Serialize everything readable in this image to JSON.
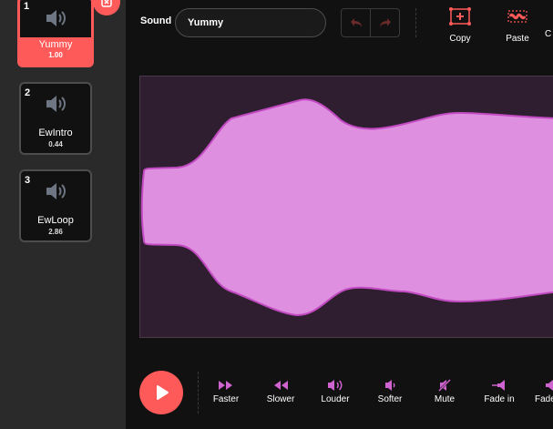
{
  "sidebar": {
    "items": [
      {
        "number": "1",
        "name": "Yummy",
        "duration": "1.00",
        "selected": true
      },
      {
        "number": "2",
        "name": "EwIntro",
        "duration": "0.44",
        "selected": false
      },
      {
        "number": "3",
        "name": "EwLoop",
        "duration": "2.86",
        "selected": false
      }
    ]
  },
  "toolbar": {
    "sound_label": "Sound",
    "sound_name": "Yummy",
    "copy_label": "Copy",
    "paste_label": "Paste",
    "cut_off_label": "C"
  },
  "effects": [
    {
      "label": "Faster",
      "icon": "fast-forward-icon"
    },
    {
      "label": "Slower",
      "icon": "rewind-icon"
    },
    {
      "label": "Louder",
      "icon": "speaker-loud-icon"
    },
    {
      "label": "Softer",
      "icon": "speaker-soft-icon"
    },
    {
      "label": "Mute",
      "icon": "speaker-mute-icon"
    },
    {
      "label": "Fade in",
      "icon": "fade-in-icon"
    },
    {
      "label": "Fade",
      "icon": "fade-out-icon"
    }
  ],
  "colors": {
    "accent": "#ff5a5a",
    "waveform_fill": "#df8fdf",
    "waveform_stroke": "#c24ac2",
    "effect_icon": "#cf63cf",
    "panel_bg": "#2f1e2f"
  }
}
